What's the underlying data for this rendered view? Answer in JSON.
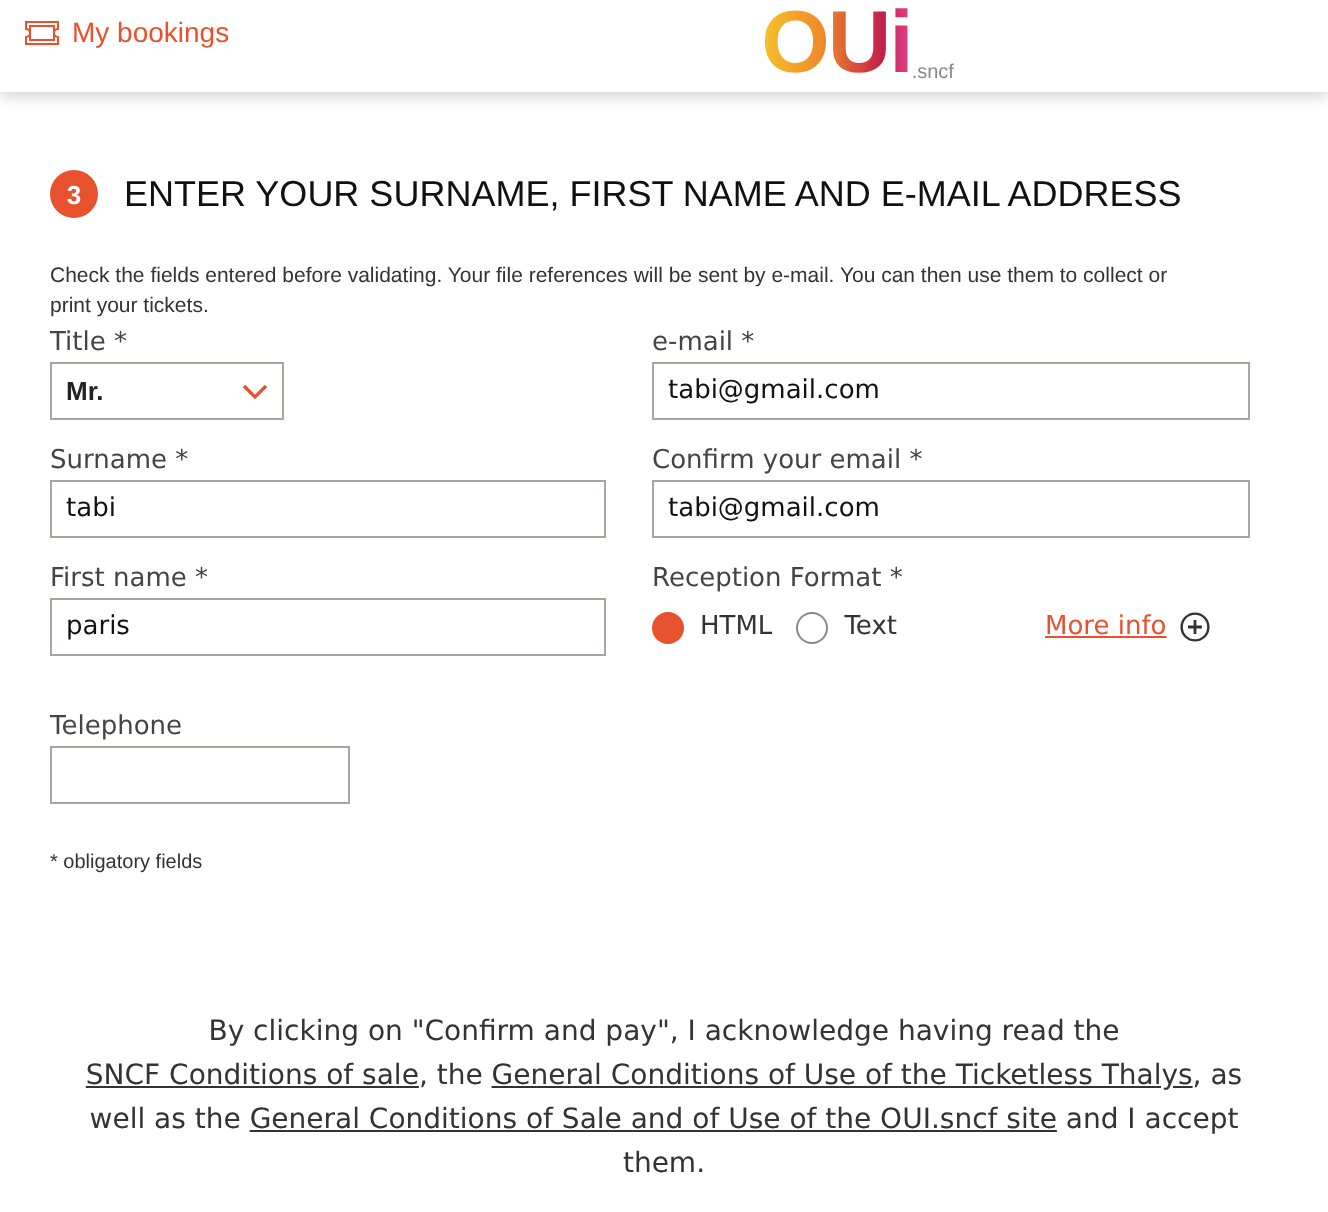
{
  "header": {
    "bookings_link": "My bookings",
    "logo": {
      "mark": "OUi",
      "suffix": ".sncf"
    }
  },
  "section": {
    "step": "3",
    "title": "ENTER YOUR SURNAME, FIRST NAME AND E-MAIL ADDRESS",
    "description": "Check the fields entered before validating. Your file references will be sent by e-mail. You can then use them to collect or print your tickets."
  },
  "left_fields": [
    {
      "kind": "select",
      "label": "Title *",
      "value": "Mr."
    },
    {
      "kind": "text",
      "label": "Surname *",
      "value": "tabi"
    },
    {
      "kind": "text",
      "label": "First name *",
      "value": "paris"
    }
  ],
  "right_fields": [
    {
      "kind": "text",
      "label": "e-mail *",
      "value": "tabi@gmail.com"
    },
    {
      "kind": "text",
      "label": "Confirm your email *",
      "value": "tabi@gmail.com"
    },
    {
      "kind": "radio",
      "label": "Reception Format *",
      "options": [
        {
          "label": "HTML",
          "selected": true
        },
        {
          "label": "Text",
          "selected": false
        }
      ],
      "more_info": "More info"
    }
  ],
  "telephone": {
    "label": "Telephone"
  },
  "footnote": "* obligatory fields",
  "legal": [
    {
      "text": "By clicking on \"Confirm and pay\", I acknowledge having read the ",
      "link": false
    },
    {
      "text": "SNCF Conditions of sale",
      "link": true
    },
    {
      "text": ", the ",
      "link": false
    },
    {
      "text": "General Conditions of Use of the Ticketless Thalys",
      "link": true
    },
    {
      "text": ", as well as the ",
      "link": false
    },
    {
      "text": "General Conditions of Sale and of Use of the OUI.sncf site",
      "link": true
    },
    {
      "text": " and I accept them.",
      "link": false
    }
  ]
}
